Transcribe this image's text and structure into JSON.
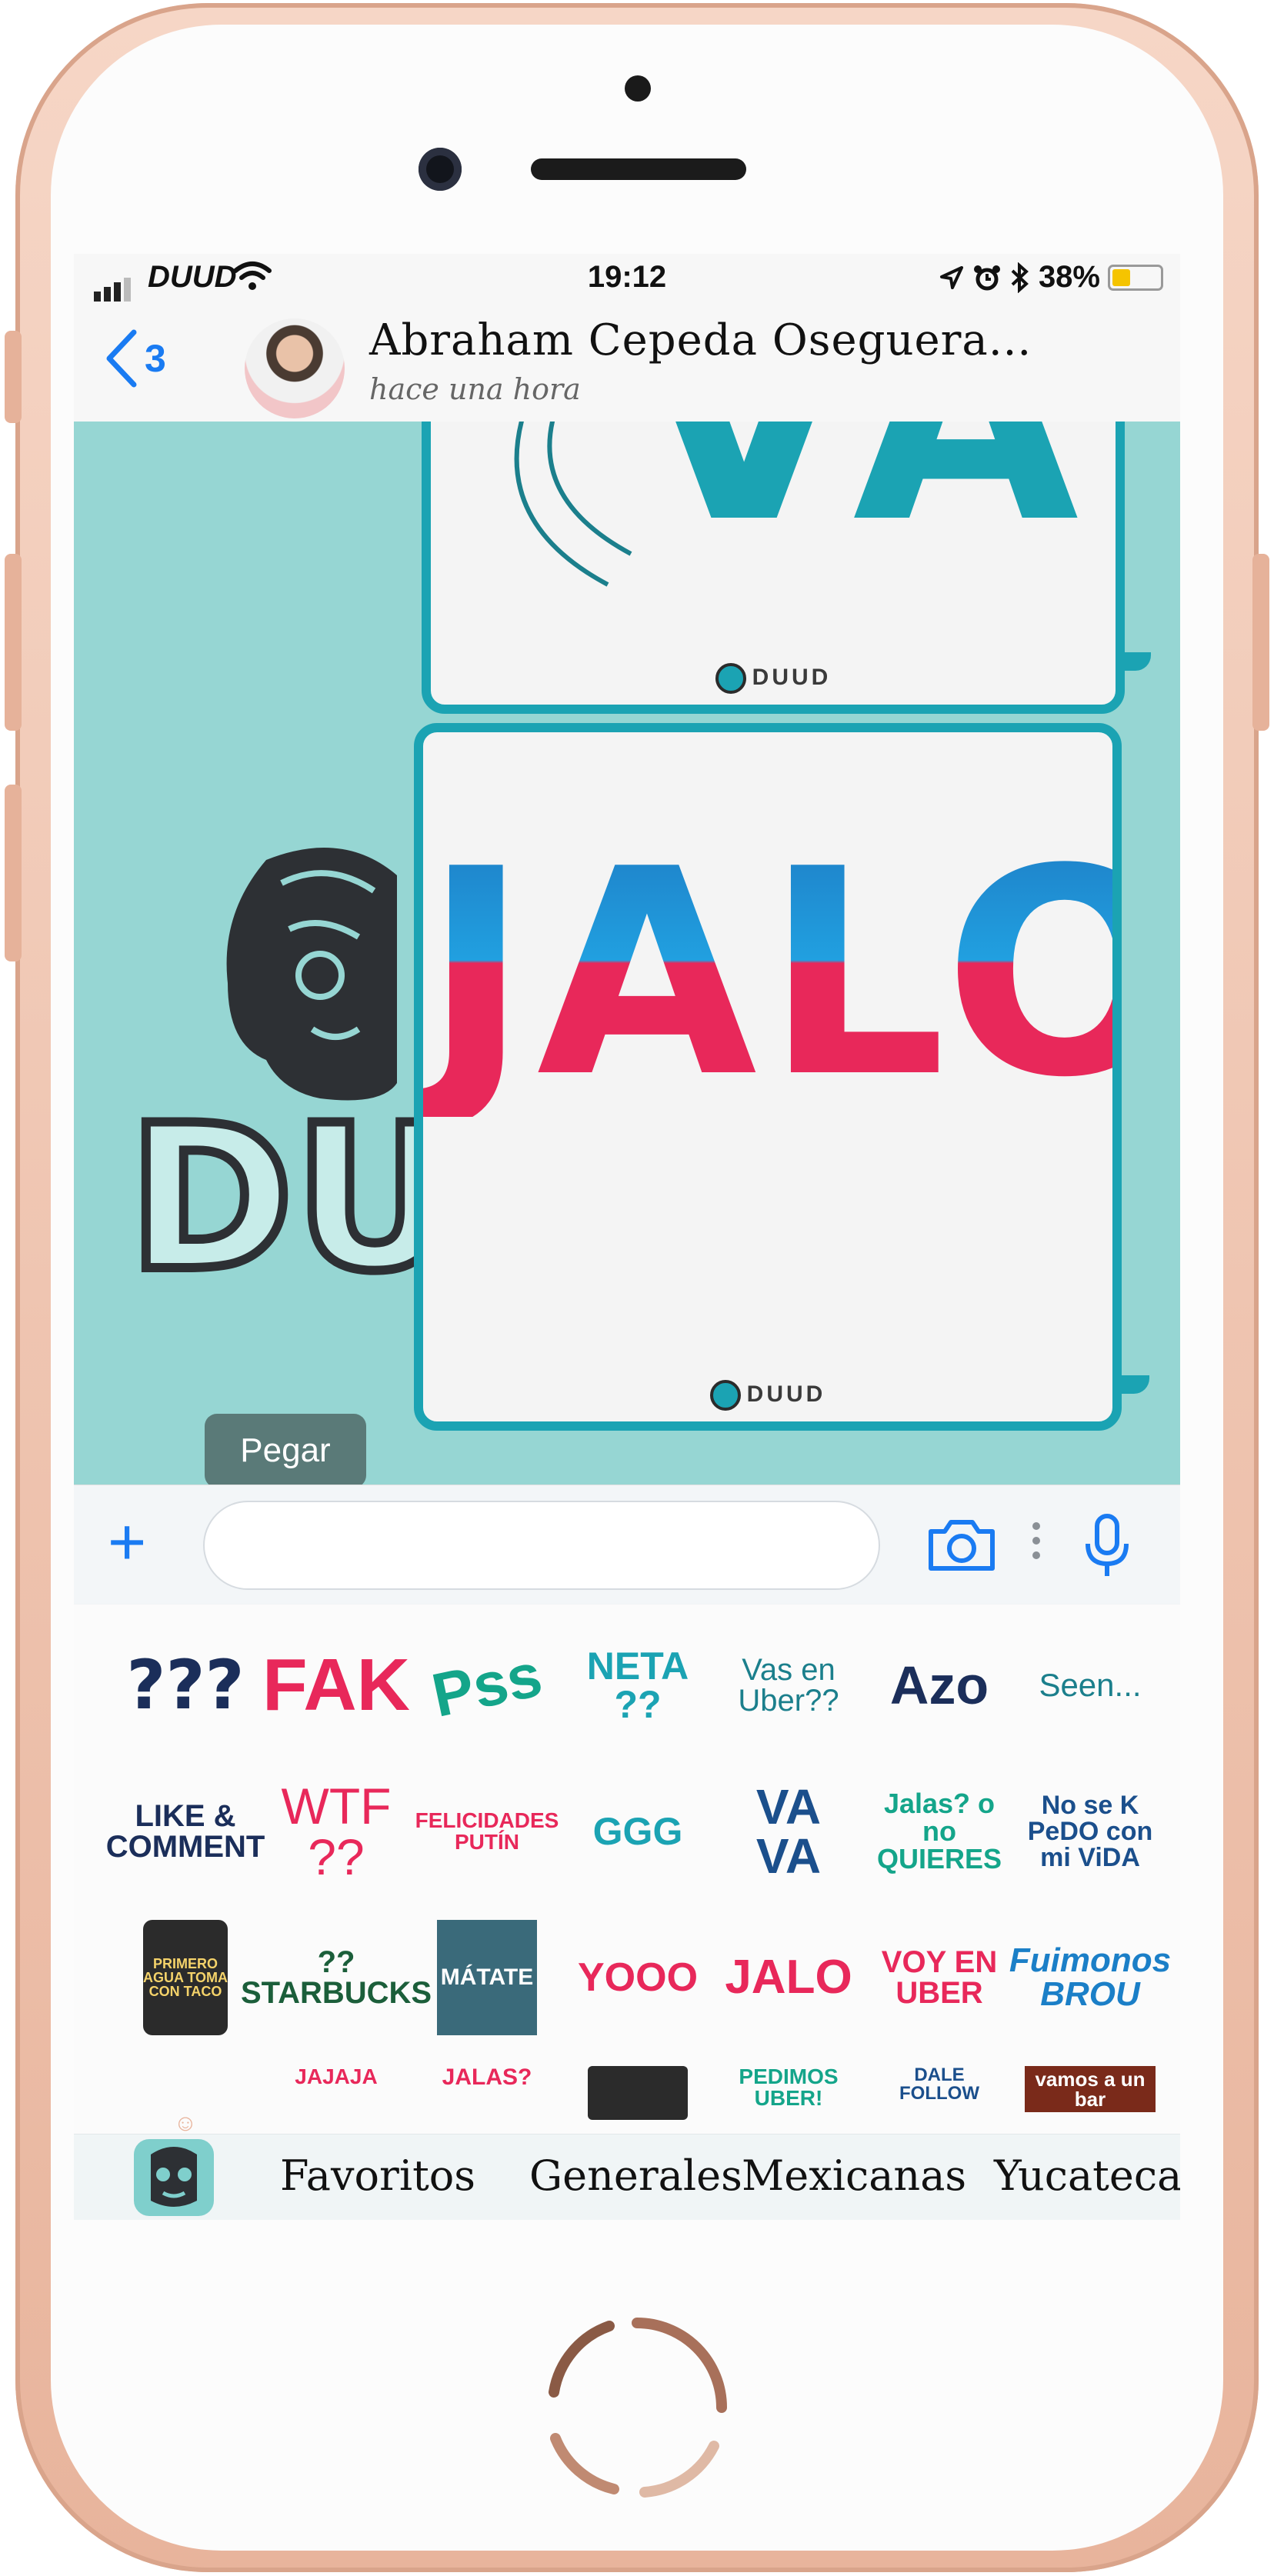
{
  "status_bar": {
    "carrier": "DUUD",
    "time": "19:12",
    "battery": "38%",
    "battery_level": 0.38,
    "icons": [
      "signal-icon",
      "wifi-icon",
      "location-icon",
      "alarm-icon",
      "bluetooth-icon",
      "battery-icon"
    ]
  },
  "header": {
    "back_count": "3",
    "contact_name": "Abraham Cepeda Oseguera...",
    "contact_status": "hace una hora"
  },
  "chat": {
    "sticker_1_text": "VA",
    "sticker_2_text": "JALO",
    "sticker_brand": "DUUD",
    "background_brand": "DUUD"
  },
  "paste_menu": {
    "label": "Pegar"
  },
  "input": {
    "placeholder": ""
  },
  "stickers": [
    {
      "text": "???"
    },
    {
      "text": "FAK"
    },
    {
      "text": "Pss"
    },
    {
      "text": "NETA ??"
    },
    {
      "text": "Vas en Uber??"
    },
    {
      "text": "Azo"
    },
    {
      "text": "Seen..."
    },
    {
      "text": "LIKE & COMMENT"
    },
    {
      "text": "WTF ??"
    },
    {
      "text": "FELICIDADES PUTÍN"
    },
    {
      "text": "GGG"
    },
    {
      "text": "VA VA"
    },
    {
      "text": "Jalas? o no QUIERES"
    },
    {
      "text": "No se K PeDO con mi ViDA"
    },
    {
      "text": "PRIMERO AGUA TOMA CON TACO"
    },
    {
      "text": "?? STARBUCKS"
    },
    {
      "text": "MÁTATE"
    },
    {
      "text": "YOOO"
    },
    {
      "text": "JALO"
    },
    {
      "text": "VOY EN UBER"
    },
    {
      "text": "Fuimonos BROU"
    },
    {
      "text": "JAJAJA"
    },
    {
      "text": "JALAS?"
    },
    {
      "text": "PEDIMOS UBER!"
    },
    {
      "text": "DALE FOLLOW"
    },
    {
      "text": "vamos a un bar"
    }
  ],
  "categories": [
    "Favoritos",
    "Generales",
    "Mexicanas",
    "Yucatecas"
  ],
  "colors": {
    "accent_blue": "#1a7bf2",
    "chat_bg": "#96d6d3",
    "bubble_border": "#1ba3b3",
    "jalo_red": "#e8285a",
    "jalo_blue": "#1e7fc7",
    "phone_frame": "#f0c3ad"
  }
}
